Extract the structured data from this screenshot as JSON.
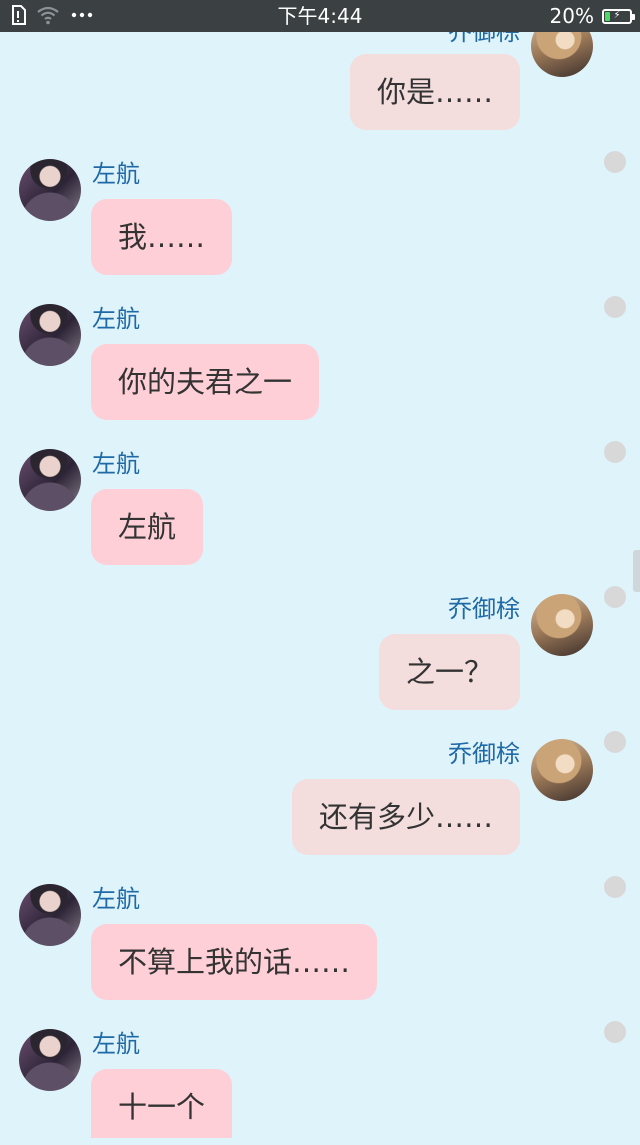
{
  "status_bar": {
    "time": "下午4:44",
    "battery": "20%",
    "battery_level": 0.2,
    "icons": [
      "sim-icon",
      "wifi-icon",
      "more-dots-icon",
      "battery-icon"
    ]
  },
  "colors": {
    "background": "#dff3fb",
    "status_bar": "#3b4043",
    "name_text": "#1f6aa6",
    "bubble_left": "#ffcfd7",
    "bubble_right": "#f3dddd",
    "battery_fill": "#4cd964"
  },
  "messages": [
    {
      "side": "right",
      "sender": "乔御梌",
      "text": "你是……"
    },
    {
      "side": "left",
      "sender": "左航",
      "text": "我……"
    },
    {
      "side": "left",
      "sender": "左航",
      "text": "你的夫君之一"
    },
    {
      "side": "left",
      "sender": "左航",
      "text": "左航"
    },
    {
      "side": "right",
      "sender": "乔御梌",
      "text": "之一？"
    },
    {
      "side": "right",
      "sender": "乔御梌",
      "text": "还有多少……"
    },
    {
      "side": "left",
      "sender": "左航",
      "text": "不算上我的话……"
    },
    {
      "side": "left",
      "sender": "左航",
      "text": "十一个"
    }
  ]
}
